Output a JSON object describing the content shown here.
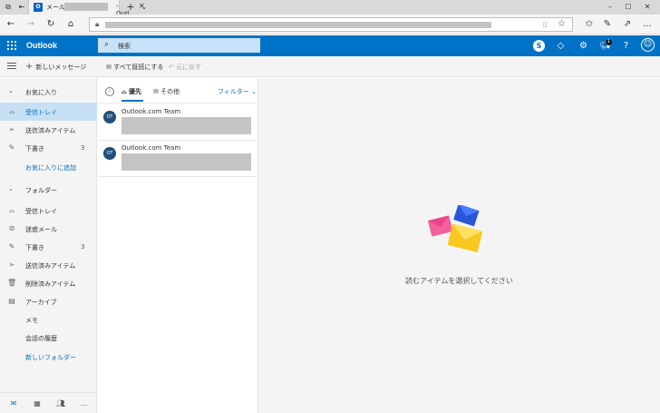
{
  "browser": {
    "tab_title_prefix": "メール - ",
    "tab_title_suffix": "- Outl",
    "favicon_letter": "O"
  },
  "outlook": {
    "brand": "Outlook",
    "search_placeholder": "検索",
    "notifications_count": "1",
    "help_label": "?"
  },
  "command_bar": {
    "new_message": "新しいメッセージ",
    "mark_all_read": "すべて既読にする",
    "undo": "元に戻す"
  },
  "left_nav": {
    "favorites_header": "お気に入り",
    "favorites": [
      {
        "label": "受信トレイ",
        "count": ""
      },
      {
        "label": "送信済みアイテム",
        "count": ""
      },
      {
        "label": "下書き",
        "count": "3"
      }
    ],
    "add_favorite": "お気に入りに追加",
    "folders_header": "フォルダー",
    "folders": [
      {
        "label": "受信トレイ",
        "count": ""
      },
      {
        "label": "迷惑メール",
        "count": ""
      },
      {
        "label": "下書き",
        "count": "3"
      },
      {
        "label": "送信済みアイテム",
        "count": ""
      },
      {
        "label": "削除済みアイテム",
        "count": ""
      },
      {
        "label": "アーカイブ",
        "count": ""
      },
      {
        "label": "メモ",
        "count": ""
      },
      {
        "label": "会話の履歴",
        "count": ""
      }
    ],
    "new_folder": "新しいフォルダー"
  },
  "message_list": {
    "tab_focused": "優先",
    "tab_other": "その他",
    "filter": "フィルター",
    "messages": [
      {
        "initials": "OT",
        "sender": "Outlook.com Team"
      },
      {
        "initials": "OT",
        "sender": "Outlook.com Team"
      }
    ]
  },
  "reading_pane": {
    "empty_text": "読むアイテムを選択してください"
  },
  "colors": {
    "brand_blue": "#0072c6",
    "selected_bg": "#c7e0f4"
  }
}
